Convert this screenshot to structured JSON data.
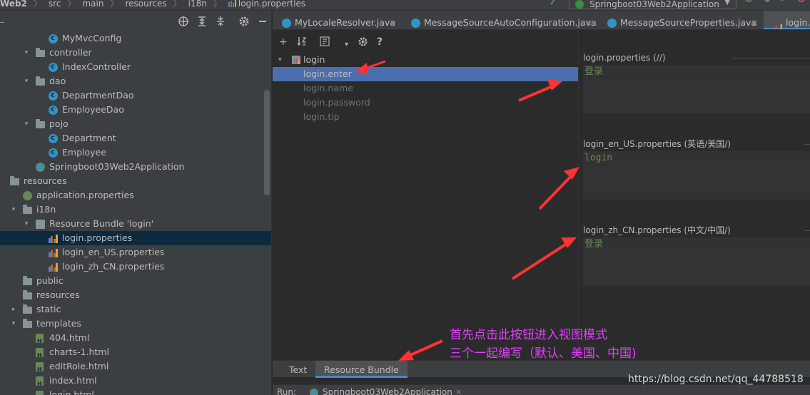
{
  "breadcrumb": {
    "items": [
      "Web2",
      "src",
      "main",
      "resources",
      "i18n",
      "login.properties"
    ]
  },
  "run_config": {
    "name": "Springboot03Web2Application"
  },
  "project_tree": {
    "rows": [
      {
        "label": "MyMvcConfig",
        "icon": "class-icon",
        "indent": 3,
        "arrow": ""
      },
      {
        "label": "controller",
        "icon": "folder-icon",
        "indent": 2,
        "arrow": "▾"
      },
      {
        "label": "IndexController",
        "icon": "class-icon",
        "indent": 3,
        "arrow": ""
      },
      {
        "label": "dao",
        "icon": "folder-icon",
        "indent": 2,
        "arrow": "▾"
      },
      {
        "label": "DepartmentDao",
        "icon": "class-icon",
        "indent": 3,
        "arrow": ""
      },
      {
        "label": "EmployeeDao",
        "icon": "class-icon",
        "indent": 3,
        "arrow": ""
      },
      {
        "label": "pojo",
        "icon": "folder-icon",
        "indent": 2,
        "arrow": "▾"
      },
      {
        "label": "Department",
        "icon": "class-icon",
        "indent": 3,
        "arrow": ""
      },
      {
        "label": "Employee",
        "icon": "class-icon",
        "indent": 3,
        "arrow": ""
      },
      {
        "label": "Springboot03Web2Application",
        "icon": "app-icon",
        "indent": 2,
        "arrow": ""
      },
      {
        "label": "resources",
        "icon": "folder-icon",
        "indent": 0,
        "arrow": ""
      },
      {
        "label": "application.properties",
        "icon": "spring-icon",
        "indent": 1,
        "arrow": ""
      },
      {
        "label": "i18n",
        "icon": "folder-icon",
        "indent": 1,
        "arrow": "▾"
      },
      {
        "label": "Resource Bundle 'login'",
        "icon": "bundle-icon",
        "indent": 2,
        "arrow": "▾"
      },
      {
        "label": "login.properties",
        "icon": "properties-icon",
        "indent": 3,
        "arrow": "",
        "selected": true
      },
      {
        "label": "login_en_US.properties",
        "icon": "properties-icon",
        "indent": 3,
        "arrow": ""
      },
      {
        "label": "login_zh_CN.properties",
        "icon": "properties-icon",
        "indent": 3,
        "arrow": ""
      },
      {
        "label": "public",
        "icon": "folder-icon",
        "indent": 1,
        "arrow": ""
      },
      {
        "label": "resources",
        "icon": "folder-icon",
        "indent": 1,
        "arrow": ""
      },
      {
        "label": "static",
        "icon": "folder-icon",
        "indent": 1,
        "arrow": "▸"
      },
      {
        "label": "templates",
        "icon": "folder-icon",
        "indent": 1,
        "arrow": "▾"
      },
      {
        "label": "404.html",
        "icon": "html-icon",
        "indent": 2,
        "arrow": ""
      },
      {
        "label": "charts-1.html",
        "icon": "html-icon",
        "indent": 2,
        "arrow": ""
      },
      {
        "label": "editRole.html",
        "icon": "html-icon",
        "indent": 2,
        "arrow": ""
      },
      {
        "label": "index.html",
        "icon": "html-icon",
        "indent": 2,
        "arrow": ""
      },
      {
        "label": "login.html",
        "icon": "html-icon",
        "indent": 2,
        "arrow": ""
      }
    ]
  },
  "editor_tabs": [
    {
      "label": "MyLocaleResolver.java",
      "active": false
    },
    {
      "label": "MessageSourceAutoConfiguration.java",
      "active": false
    },
    {
      "label": "MessageSourceProperties.java",
      "active": false
    },
    {
      "label": "login.p",
      "active": true
    }
  ],
  "resource_bundle": {
    "root_key": "login",
    "keys": [
      {
        "label": "login.enter",
        "selected": true
      },
      {
        "label": "login.name",
        "selected": false
      },
      {
        "label": "login.password",
        "selected": false
      },
      {
        "label": "login.tip",
        "selected": false
      }
    ],
    "values": [
      {
        "title": "login.properties (//)",
        "value": "登录",
        "mono": false
      },
      {
        "title": "login_en_US.properties (英语/美国/)",
        "value": "login",
        "mono": true
      },
      {
        "title": "login_zh_CN.properties (中文/中国/)",
        "value": "登录",
        "mono": false
      }
    ]
  },
  "bottom_tabs": [
    {
      "label": "Text",
      "active": false
    },
    {
      "label": "Resource Bundle",
      "active": true
    }
  ],
  "run_bar": {
    "label": "Run:",
    "config": "Springboot03Web2Application"
  },
  "annotations": {
    "note_line1": "首先点击此按钮进入视图模式",
    "note_line2": "三个一起编写（默认、美国、中国)",
    "arrow_color": "#ff3333",
    "text_color": "#e040fb"
  },
  "watermark": "https://blog.csdn.net/qq_44788518"
}
